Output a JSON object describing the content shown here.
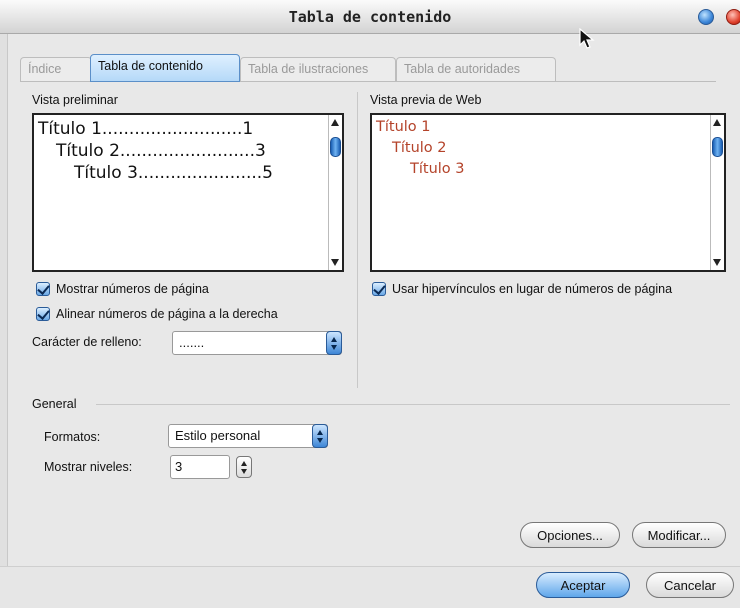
{
  "window": {
    "title": "Tabla de contenido"
  },
  "tabs": [
    {
      "label": "Índice",
      "active": false
    },
    {
      "label": "Tabla de contenido",
      "active": true
    },
    {
      "label": "Tabla de ilustraciones",
      "active": false
    },
    {
      "label": "Tabla de autoridades",
      "active": false
    }
  ],
  "print_preview": {
    "label": "Vista preliminar",
    "lines": [
      "Título 1..........................1",
      "Título 2.........................3",
      "Título 3.......................5"
    ]
  },
  "web_preview": {
    "label": "Vista previa de Web",
    "lines": [
      "Título 1",
      "Título 2",
      "Título 3"
    ],
    "link_color": "#b4432a"
  },
  "options": {
    "show_page_numbers": {
      "label": "Mostrar números de página",
      "checked": true
    },
    "align_right": {
      "label": "Alinear números de página a la derecha",
      "checked": true
    },
    "use_hyperlinks": {
      "label": "Usar hipervínculos en lugar de números de página",
      "checked": true
    },
    "tab_leader": {
      "label": "Carácter de relleno:",
      "value": "......."
    }
  },
  "general": {
    "heading": "General",
    "formats": {
      "label": "Formatos:",
      "value": "Estilo personal"
    },
    "levels": {
      "label": "Mostrar niveles:",
      "value": "3"
    }
  },
  "buttons": {
    "options": "Opciones...",
    "modify": "Modificar...",
    "ok": "Aceptar",
    "cancel": "Cancelar"
  },
  "colors": {
    "accent": "#3d86d6",
    "close": "#e0422e"
  }
}
